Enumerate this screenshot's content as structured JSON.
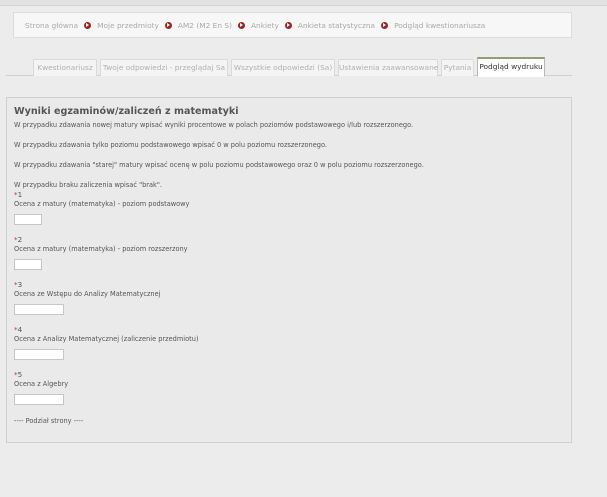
{
  "breadcrumb": [
    "Strona główna",
    "Moje przedmioty",
    "AM2 (M2 En S)",
    "Ankiety",
    "Ankieta statystyczna",
    "Podgląd kwestionariusza"
  ],
  "tabs": [
    {
      "label": "Kwestionariusz",
      "active": false
    },
    {
      "label": "Twoje odpowiedzi - przeglądaj Sa",
      "active": false
    },
    {
      "label": "Wszystkie odpowiedzi (Sa)",
      "active": false
    },
    {
      "label": "Ustawienia zaawansowane",
      "active": false
    },
    {
      "label": "Pytania",
      "active": false
    },
    {
      "label": "Podgląd wydruku",
      "active": true
    }
  ],
  "section": {
    "title": "Wyniki egzaminów/zaliczeń z matematyki",
    "instructions": [
      "W przypadku zdawania nowej matury wpisać wyniki procentowe w polach poziomów podstawowego i/lub rozszerzonego.",
      "W przypadku zdawania tylko poziomu podstawowego wpisać 0 w polu poziomu rozszerzonego.",
      "W przypadku zdawania \"starej\" matury wpisać ocenę w polu poziomu podstawowego oraz 0 w polu poziomu rozszerzonego.",
      "W przypadku braku zaliczenia wpisać \"brak\"."
    ]
  },
  "questions": [
    {
      "required_mark": "*",
      "number": "1",
      "label": "Ocena z matury (matematyka) - poziom podstawowy",
      "value": ""
    },
    {
      "required_mark": "*",
      "number": "2",
      "label": "Ocena z matury (matematyka) - poziom rozszerzony",
      "value": ""
    },
    {
      "required_mark": "*",
      "number": "3",
      "label": "Ocena ze Wstępu do Analizy Matematycznej",
      "value": ""
    },
    {
      "required_mark": "*",
      "number": "4",
      "label": "Ocena z Analizy Matematycznej (zaliczenie przedmiotu)",
      "value": ""
    },
    {
      "required_mark": "*",
      "number": "5",
      "label": "Ocena z Algebry",
      "value": ""
    }
  ],
  "page_break": "---- Podział strony ----"
}
